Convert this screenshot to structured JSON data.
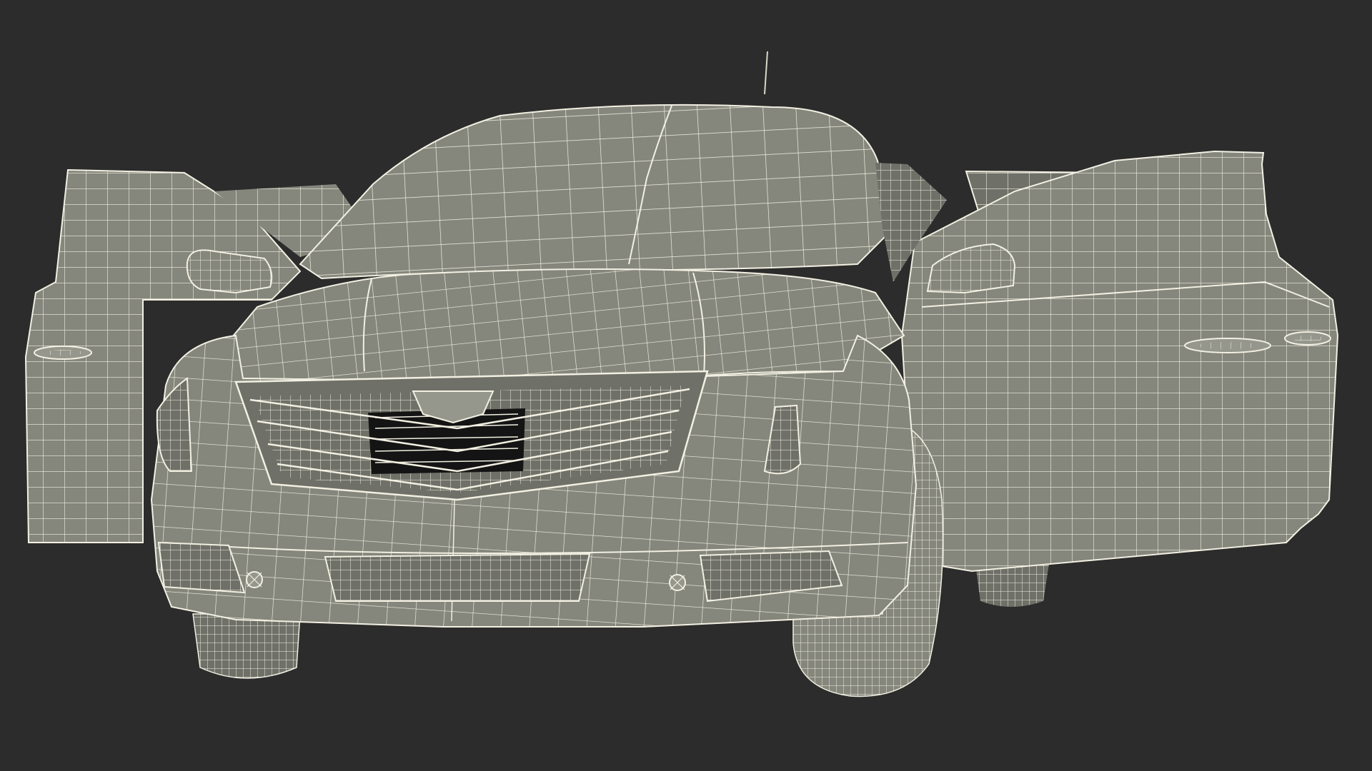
{
  "scene": {
    "subject": "car-wireframe-model",
    "view": "front",
    "doors_open": true
  },
  "colors": {
    "background": "#2c2c2c",
    "surface": "#85867c",
    "surface_shade": "#6f7068",
    "surface_light": "#96978c",
    "wire": "#f2f0e2",
    "wire_dim": "#d9d7c6",
    "opening": "#141414"
  }
}
